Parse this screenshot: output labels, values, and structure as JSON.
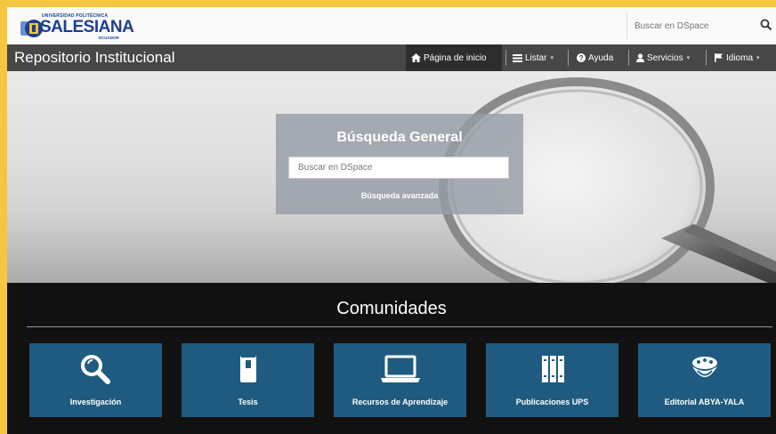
{
  "header": {
    "logo": {
      "small_text": "UNIVERSIDAD POLITÉCNICA",
      "main_text": "SALESIANA",
      "sub_text": "ECUADOR"
    },
    "search": {
      "placeholder": "Buscar en DSpace",
      "icon": "search-icon"
    }
  },
  "navbar": {
    "brand": "Repositorio Institucional",
    "items": [
      {
        "label": "Página de inicio",
        "icon": "home-icon",
        "active": true
      },
      {
        "label": "Listar",
        "icon": "list-icon",
        "caret": "▾"
      },
      {
        "label": "Ayuda",
        "icon": "help-icon"
      },
      {
        "label": "Servicios",
        "icon": "user-icon",
        "caret": "▾"
      },
      {
        "label": "Idioma",
        "icon": "flag-icon",
        "caret": "▾"
      }
    ]
  },
  "hero": {
    "title": "Búsqueda General",
    "search_placeholder": "Buscar en DSpace",
    "advanced_link": "Búsqueda avanzada"
  },
  "communities": {
    "title": "Comunidades",
    "cards": [
      {
        "label": "Investigación",
        "icon": "magnifier-icon"
      },
      {
        "label": "Tesis",
        "icon": "book-icon"
      },
      {
        "label": "Recursos de Aprendizaje",
        "icon": "laptop-icon"
      },
      {
        "label": "Publicaciones UPS",
        "icon": "books-icon"
      },
      {
        "label": "Editorial ABYA-YALA",
        "icon": "emblem-icon"
      }
    ]
  },
  "colors": {
    "frame_border": "#f6c641",
    "navbar": "#474747",
    "card": "#1f5b80",
    "communities_bg": "#111111"
  }
}
